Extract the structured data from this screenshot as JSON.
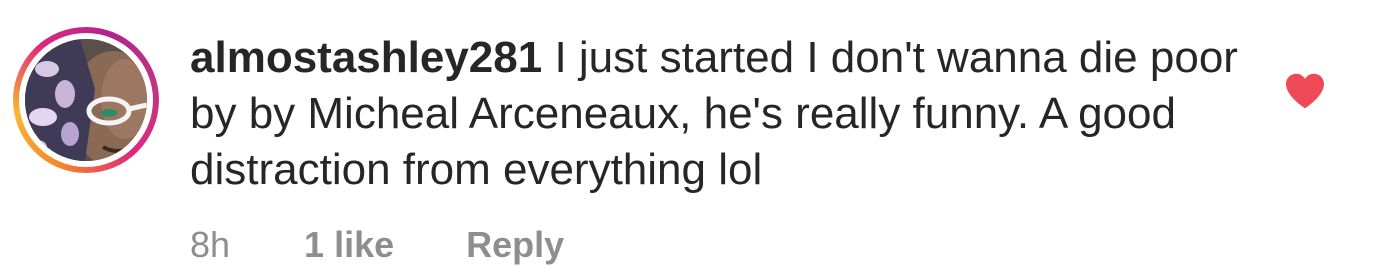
{
  "comment": {
    "username": "almostashley281",
    "text": "I just started I don't wanna die poor by by Micheal Arceneaux, he's really funny. A good distraction from everything lol",
    "time": "8h",
    "likes": "1 like",
    "reply_label": "Reply",
    "heart_icon": "heart-icon",
    "heart_color": "#ed4956",
    "avatar_ring_colors": [
      "#f58529",
      "#dd2a7b",
      "#b0248d"
    ]
  }
}
